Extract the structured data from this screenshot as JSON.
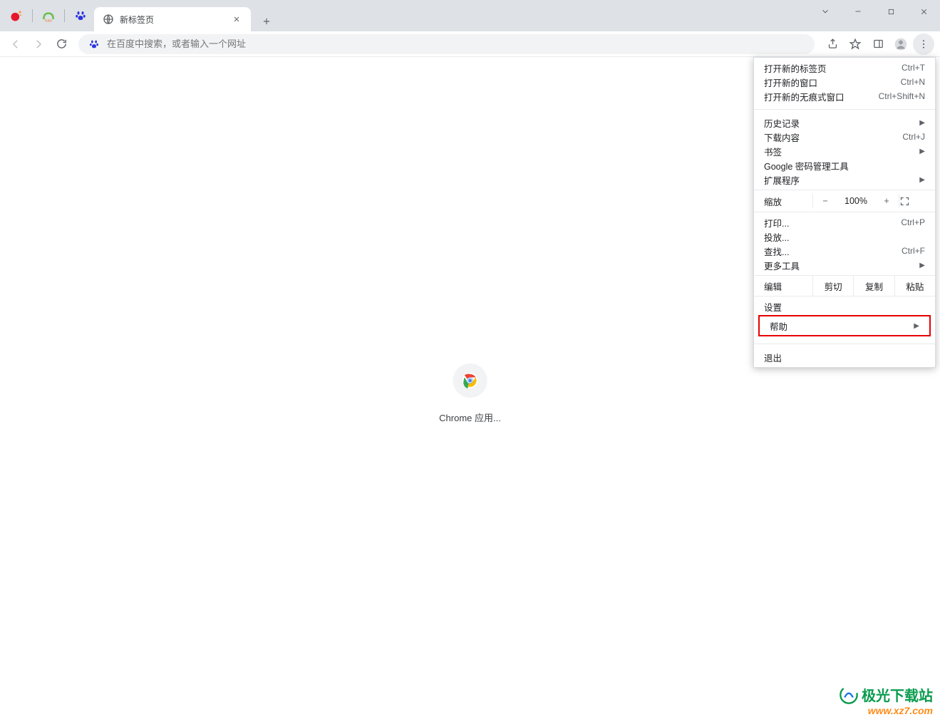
{
  "tab": {
    "title": "新标签页"
  },
  "omnibox": {
    "placeholder": "在百度中搜索，或者输入一个网址"
  },
  "content": {
    "app_label": "Chrome 应用..."
  },
  "menu": {
    "new_tab": "打开新的标签页",
    "new_tab_sc": "Ctrl+T",
    "new_window": "打开新的窗口",
    "new_window_sc": "Ctrl+N",
    "new_incognito": "打开新的无痕式窗口",
    "new_incognito_sc": "Ctrl+Shift+N",
    "history": "历史记录",
    "downloads": "下载内容",
    "downloads_sc": "Ctrl+J",
    "bookmarks": "书签",
    "password_manager": "Google 密码管理工具",
    "extensions": "扩展程序",
    "zoom_label": "缩放",
    "zoom_value": "100%",
    "print": "打印...",
    "print_sc": "Ctrl+P",
    "cast": "投放...",
    "find": "查找...",
    "find_sc": "Ctrl+F",
    "more_tools": "更多工具",
    "edit_label": "编辑",
    "cut": "剪切",
    "copy": "复制",
    "paste": "粘贴",
    "settings": "设置",
    "help": "帮助",
    "exit": "退出"
  },
  "watermark": {
    "brand": "极光下载站",
    "url": "www.xz7.com"
  }
}
